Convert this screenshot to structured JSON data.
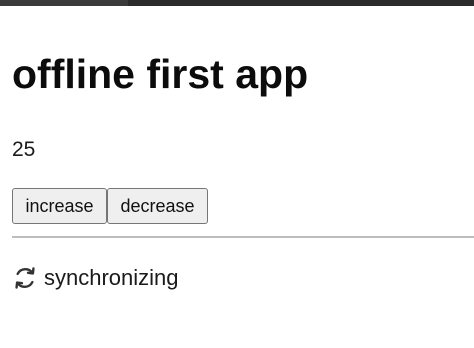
{
  "app": {
    "title": "offline first app",
    "counter_value": "25"
  },
  "controls": {
    "increase_label": "increase",
    "decrease_label": "decrease"
  },
  "status": {
    "text": "synchronizing",
    "icon": "sync-icon"
  },
  "colors": {
    "button_bg": "#efefef",
    "button_border": "#767676",
    "divider": "#bdbdbd"
  }
}
